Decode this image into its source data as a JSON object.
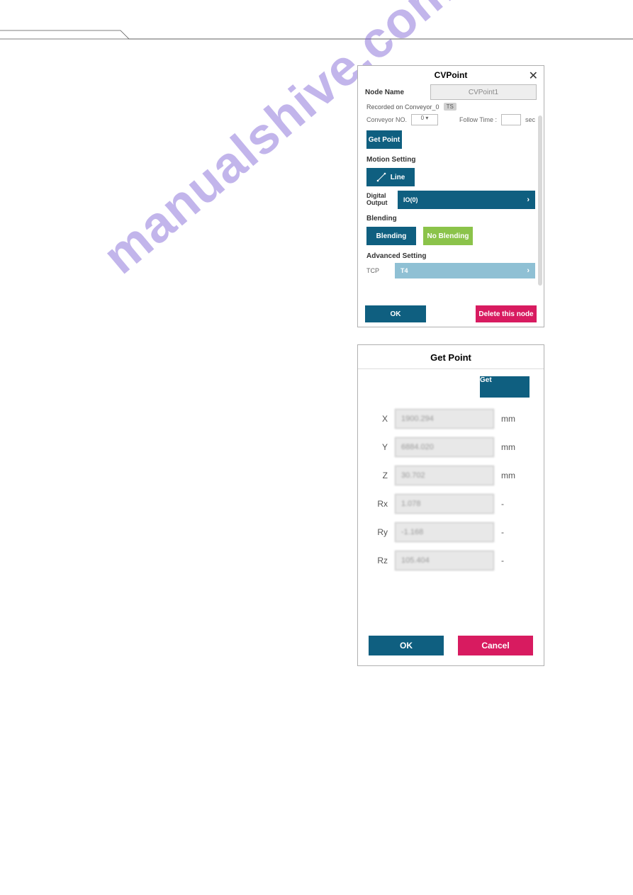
{
  "watermark": "manualshive.com",
  "cvpoint": {
    "title": "CVPoint",
    "node_name_label": "Node Name",
    "node_name_value": "CVPoint1",
    "recorded_text": "Recorded on Conveyor_0",
    "ts_badge": "TS",
    "conveyor_no_label": "Conveyor NO.",
    "conveyor_no_value": "0",
    "follow_time_label": "Follow Time :",
    "follow_time_value": "",
    "follow_time_unit": "sec",
    "get_point_btn": "Get Point",
    "motion_setting_hdr": "Motion Setting",
    "line_btn": "Line",
    "digital_output_label": "Digital Output",
    "digital_output_value": "IO(0)",
    "blending_hdr": "Blending",
    "blending_btn": "Blending",
    "no_blending_btn": "No Blending",
    "advanced_hdr": "Advanced Setting",
    "tcp_label": "TCP",
    "tcp_value": "T4",
    "ok_btn": "OK",
    "delete_btn": "Delete this node"
  },
  "getpoint": {
    "title": "Get Point",
    "get_btn": "Get",
    "rows": [
      {
        "axis": "X",
        "value": "1900.294",
        "unit": "mm"
      },
      {
        "axis": "Y",
        "value": "6884.020",
        "unit": "mm"
      },
      {
        "axis": "Z",
        "value": "30.702",
        "unit": "mm"
      },
      {
        "axis": "Rx",
        "value": "1.078",
        "unit": "-"
      },
      {
        "axis": "Ry",
        "value": "-1.168",
        "unit": "-"
      },
      {
        "axis": "Rz",
        "value": "105.404",
        "unit": "-"
      }
    ],
    "ok_btn": "OK",
    "cancel_btn": "Cancel"
  }
}
